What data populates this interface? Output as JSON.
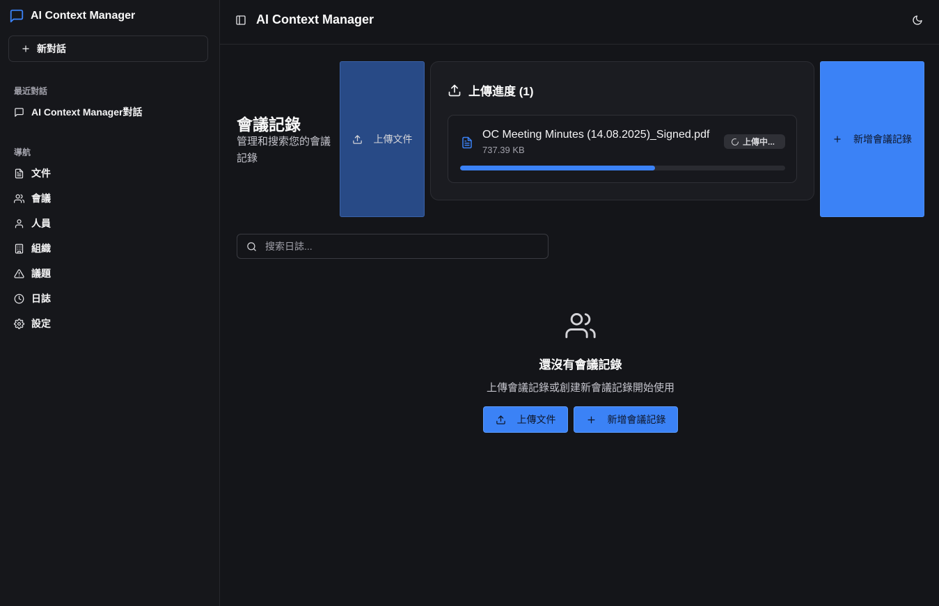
{
  "app": {
    "brand_title": "AI Context Manager",
    "header_title": "AI Context Manager"
  },
  "sidebar": {
    "new_chat_label": "新對話",
    "recent_label": "最近對話",
    "recent_items": [
      {
        "label": "AI Context Manager對話",
        "icon": "message-square-icon"
      }
    ],
    "nav_label": "導航",
    "nav_items": [
      {
        "label": "文件",
        "icon": "file-text-icon"
      },
      {
        "label": "會議",
        "icon": "users-icon"
      },
      {
        "label": "人員",
        "icon": "user-icon"
      },
      {
        "label": "組織",
        "icon": "building-icon"
      },
      {
        "label": "議題",
        "icon": "alert-triangle-icon"
      },
      {
        "label": "日誌",
        "icon": "clock-icon"
      },
      {
        "label": "設定",
        "icon": "settings-icon"
      }
    ]
  },
  "page": {
    "title": "會議記錄",
    "subtitle": "管理和搜索您的會議記錄",
    "upload_label": "上傳文件",
    "add_label": "新增會議記錄"
  },
  "upload_progress": {
    "title": "上傳進度 (1)",
    "files": [
      {
        "name": "OC Meeting Minutes (14.08.2025)_Signed.pdf",
        "size": "737.39 KB",
        "status": "上傳中...",
        "progress": 0.6
      }
    ]
  },
  "search": {
    "placeholder": "搜索日誌...",
    "value": ""
  },
  "empty_state": {
    "title": "還沒有會議記錄",
    "subtitle": "上傳會議記錄或創建新會議記錄開始使用",
    "upload_label": "上傳文件",
    "add_label": "新增會議記錄"
  },
  "colors": {
    "accent": "#3b82f6",
    "background": "#141519",
    "sidebar": "#16171b"
  }
}
